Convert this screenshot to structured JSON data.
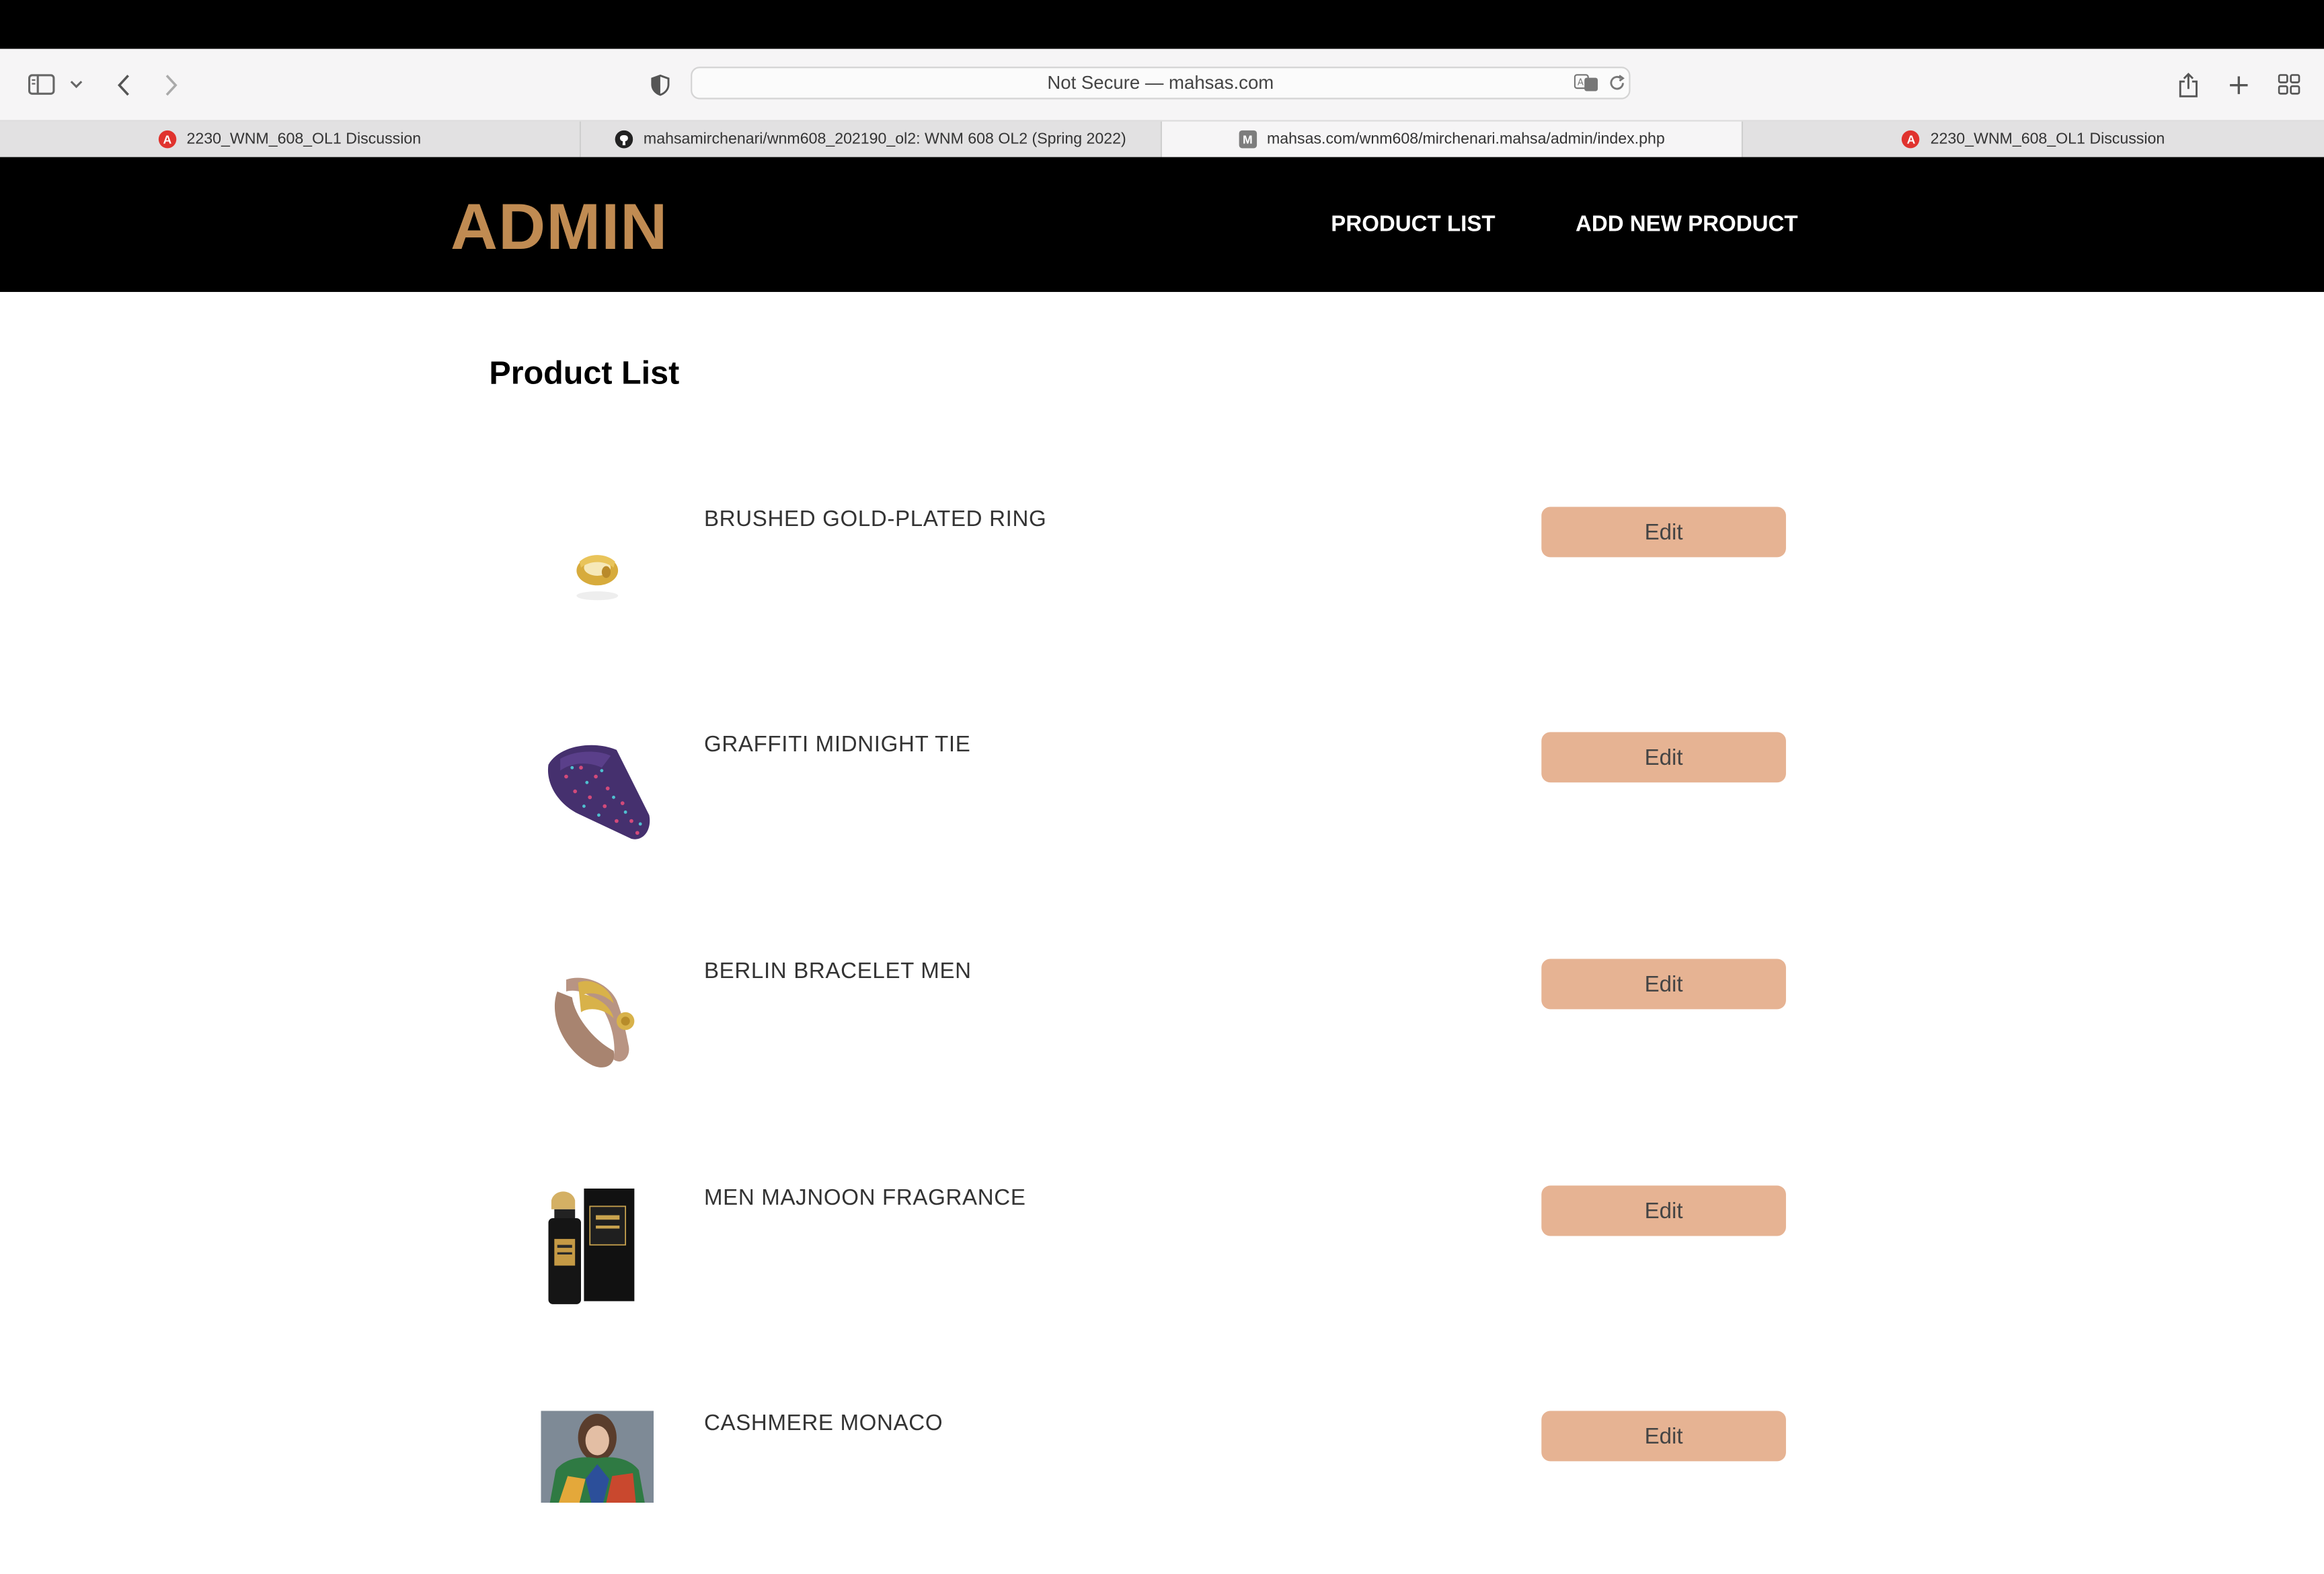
{
  "browser": {
    "address_text": "Not Secure — mahsas.com",
    "tabs": [
      {
        "label": "2230_WNM_608_OL1 Discussion",
        "favicon": "red-a-icon"
      },
      {
        "label": "mahsamirchenari/wnm608_202190_ol2: WNM 608 OL2 (Spring 2022)",
        "favicon": "github-icon"
      },
      {
        "label": "mahsas.com/wnm608/mirchenari.mahsa/admin/index.php",
        "favicon": "m-icon",
        "active": true
      },
      {
        "label": "2230_WNM_608_OL1 Discussion",
        "favicon": "red-a-icon"
      }
    ],
    "favicon_letters": {
      "red": "A",
      "m": "M"
    }
  },
  "header": {
    "logo": "ADMIN",
    "nav": {
      "product_list": "PRODUCT LIST",
      "add_new_product": "ADD NEW PRODUCT"
    }
  },
  "main": {
    "title": "Product List",
    "products": [
      {
        "name": "BRUSHED GOLD-PLATED RING",
        "edit_label": "Edit",
        "thumb": "gold-ring"
      },
      {
        "name": "GRAFFITI MIDNIGHT TIE",
        "edit_label": "Edit",
        "thumb": "navy-tie"
      },
      {
        "name": "BERLIN BRACELET MEN",
        "edit_label": "Edit",
        "thumb": "leather-bracelet"
      },
      {
        "name": "MEN MAJNOON FRAGRANCE",
        "edit_label": "Edit",
        "thumb": "perfume-bottle"
      },
      {
        "name": "CASHMERE MONACO",
        "edit_label": "Edit",
        "thumb": "model-photo"
      }
    ]
  },
  "colors": {
    "logo": "#c08b52",
    "edit_button": "#e6b393",
    "header_bg": "#000000"
  }
}
